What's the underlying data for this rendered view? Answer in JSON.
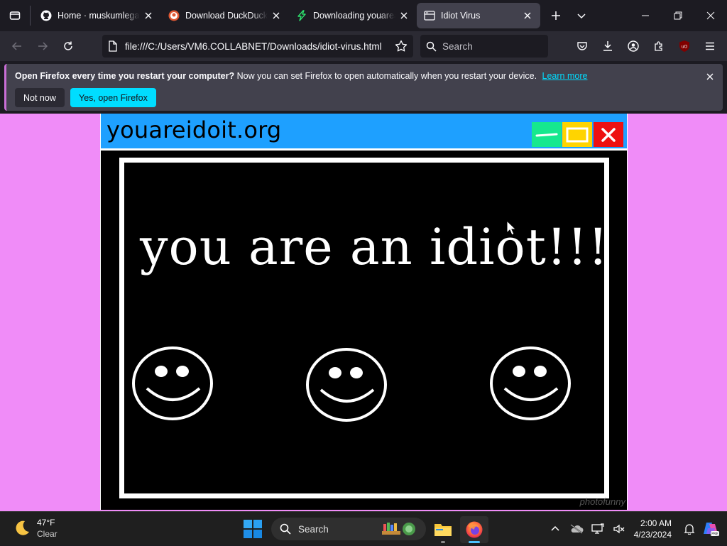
{
  "browser": {
    "tabs": [
      {
        "title": "Home · muskumlegarr",
        "active": false
      },
      {
        "title": "Download DuckDuckGo",
        "active": false
      },
      {
        "title": "Downloading youareanidiot",
        "active": false
      },
      {
        "title": "Idiot Virus",
        "active": true
      }
    ],
    "url": "file:///C:/Users/VM6.COLLABNET/Downloads/idiot-virus.html",
    "search_placeholder": "Search"
  },
  "notification": {
    "bold_text": "Open Firefox every time you restart your computer?",
    "text": "Now you can set Firefox to open automatically when you restart your device.",
    "link": "Learn more",
    "not_now": "Not now",
    "yes": "Yes, open Firefox"
  },
  "site": {
    "title": "youareidoit.org",
    "message": "you are an idiot!!!",
    "watermark": "photofunny",
    "colors": {
      "page_bg": "#f08cf8",
      "header": "#1ea0ff",
      "min": "#16e88e",
      "max": "#ffd400",
      "close": "#ee1111"
    }
  },
  "taskbar": {
    "temperature": "47°F",
    "condition": "Clear",
    "search_placeholder": "Search",
    "time": "2:00 AM",
    "date": "4/23/2024"
  }
}
